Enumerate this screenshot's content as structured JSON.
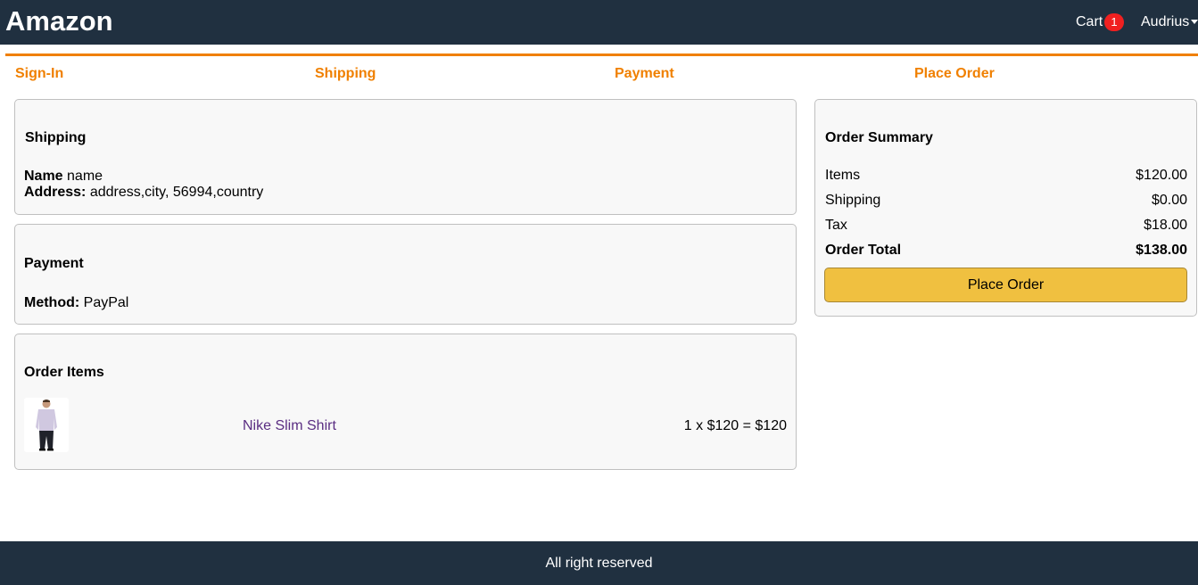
{
  "header": {
    "brand": "Amazon",
    "cart_label": "Cart",
    "cart_count": "1",
    "user_name": "Audrius"
  },
  "checkout_steps": [
    "Sign-In",
    "Shipping",
    "Payment",
    "Place Order"
  ],
  "shipping": {
    "title": "Shipping",
    "name_label": "Name",
    "name_value": "name",
    "address_label": "Address:",
    "address_value": "address,city, 56994,country"
  },
  "payment": {
    "title": "Payment",
    "method_label": "Method:",
    "method_value": "PayPal"
  },
  "order_items": {
    "title": "Order Items",
    "items": [
      {
        "name": "Nike Slim Shirt",
        "line_total": "1 x $120 = $120",
        "image_icon": "shirt-product-image"
      }
    ]
  },
  "summary": {
    "title": "Order Summary",
    "rows": [
      {
        "label": "Items",
        "value": "$120.00"
      },
      {
        "label": "Shipping",
        "value": "$0.00"
      },
      {
        "label": "Tax",
        "value": "$18.00"
      },
      {
        "label": "Order Total",
        "value": "$138.00"
      }
    ],
    "place_order_label": "Place Order"
  },
  "footer": {
    "text": "All right reserved"
  },
  "colors": {
    "header_bg": "#203040",
    "step_active": "#f08000",
    "button_bg": "#f0c040",
    "badge_bg": "#f02020",
    "product_link": "#5a2d82"
  }
}
